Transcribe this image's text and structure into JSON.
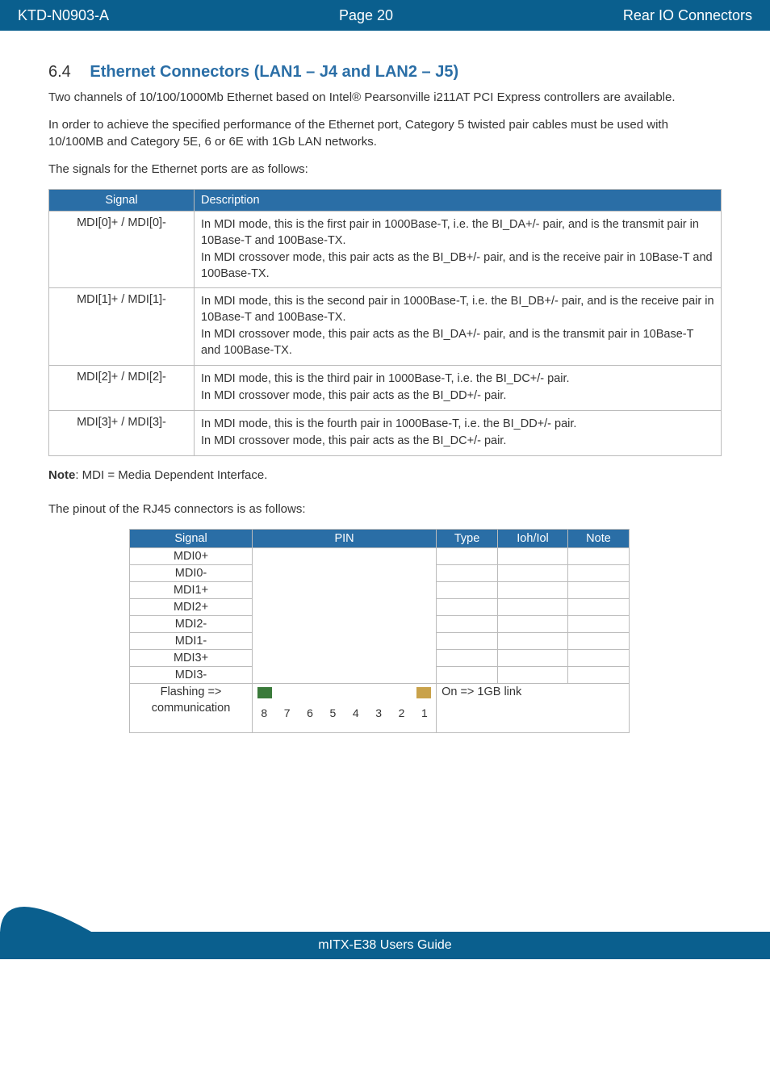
{
  "header": {
    "left": "KTD-N0903-A",
    "center": "Page 20",
    "right": "Rear IO Connectors"
  },
  "section": {
    "num": "6.4",
    "title": "Ethernet Connectors (LAN1 – J4 and LAN2 – J5)"
  },
  "para1": "Two channels of 10/100/1000Mb Ethernet based on Intel® Pearsonville i211AT PCI Express controllers are available.",
  "para2": "In order to achieve the specified performance of the Ethernet port, Category 5 twisted pair cables must be used with 10/100MB and Category 5E, 6 or 6E with 1Gb LAN networks.",
  "para3": "The signals for the Ethernet ports are as follows:",
  "t1": {
    "head": {
      "signal": "Signal",
      "desc": "Description"
    },
    "rows": [
      {
        "sig": "MDI[0]+ / MDI[0]-",
        "d1": "In MDI mode, this is the first pair in 1000Base-T, i.e. the BI_DA+/- pair, and is the transmit pair in 10Base-T and 100Base-TX.",
        "d2": "In MDI crossover mode, this pair acts as the BI_DB+/- pair, and is the receive pair in 10Base-T and 100Base-TX."
      },
      {
        "sig": "MDI[1]+ / MDI[1]-",
        "d1": "In MDI mode, this is the second pair in 1000Base-T, i.e. the BI_DB+/- pair, and is the receive pair in 10Base-T and 100Base-TX.",
        "d2": "In MDI crossover mode, this pair acts as the BI_DA+/- pair, and is the transmit pair in 10Base-T and 100Base-TX."
      },
      {
        "sig": "MDI[2]+ / MDI[2]-",
        "d1": "In MDI mode, this is the third pair in 1000Base-T, i.e. the BI_DC+/- pair.",
        "d2": "In MDI crossover mode, this pair acts as the BI_DD+/- pair."
      },
      {
        "sig": "MDI[3]+ / MDI[3]-",
        "d1": "In MDI mode, this is the fourth pair in 1000Base-T, i.e. the BI_DD+/- pair.",
        "d2": "In MDI crossover mode, this pair acts as the BI_DC+/- pair."
      }
    ]
  },
  "note_pre": "Note",
  "note_rest": ": MDI = Media Dependent Interface.",
  "para5": "The pinout of the RJ45 connectors is as follows:",
  "t2": {
    "head": {
      "signal": "Signal",
      "pin": "PIN",
      "type": "Type",
      "ioh": "Ioh/Iol",
      "note": "Note"
    },
    "rows": [
      "MDI0+",
      "MDI0-",
      "MDI1+",
      "MDI2+",
      "MDI2-",
      "MDI1-",
      "MDI3+",
      "MDI3-"
    ],
    "lastSig1": "Flashing =>",
    "lastSig2": "communication",
    "lastType": "On => 1GB link",
    "pins": [
      "8",
      "7",
      "6",
      "5",
      "4",
      "3",
      "2",
      "1"
    ]
  },
  "footer": "mITX-E38 Users Guide"
}
